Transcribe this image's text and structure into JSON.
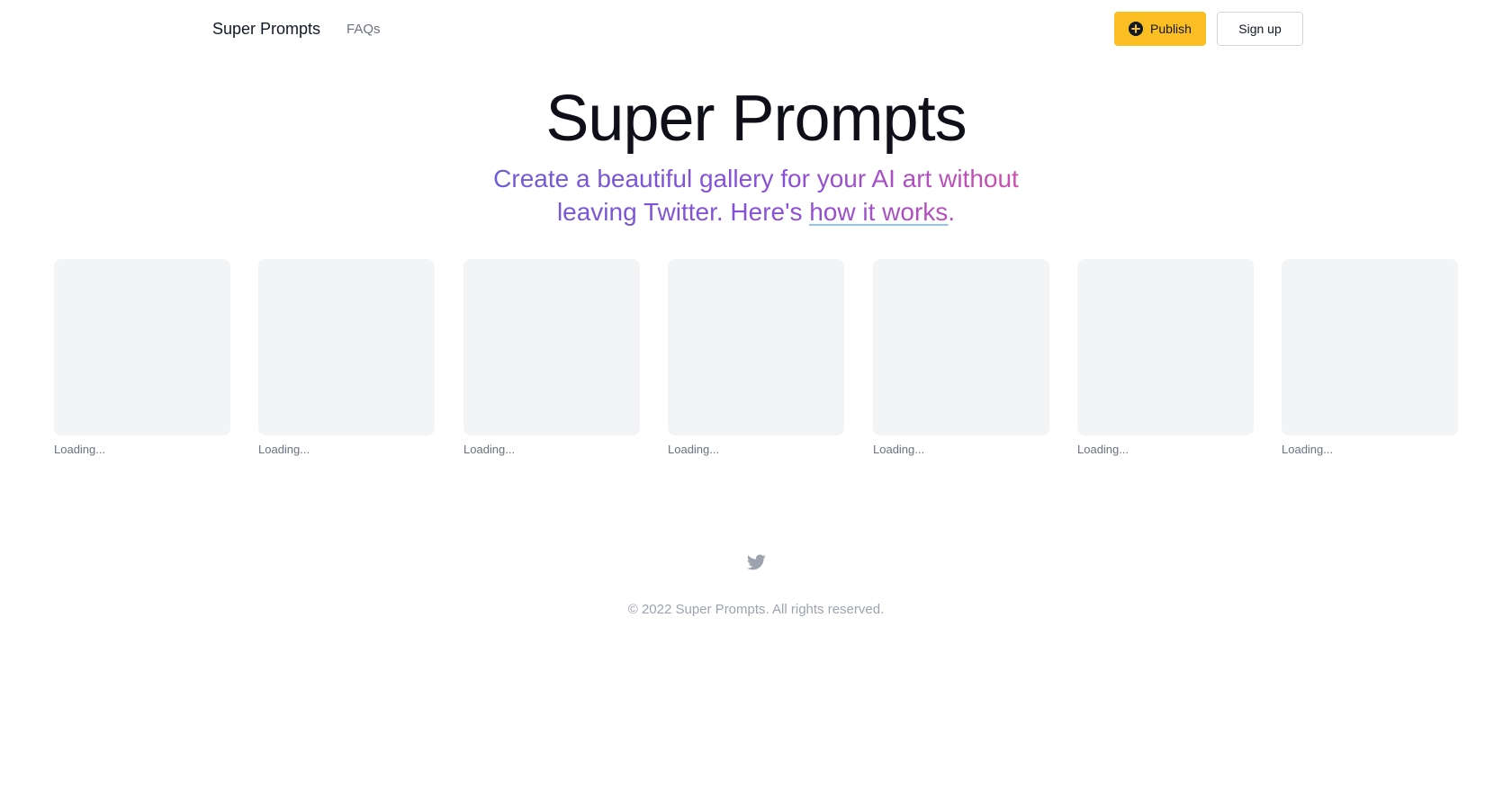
{
  "header": {
    "brand": "Super Prompts",
    "nav": {
      "faqs": "FAQs"
    },
    "publish_label": "Publish",
    "signup_label": "Sign up",
    "publish_icon": "plus-circle-icon"
  },
  "hero": {
    "title": "Super Prompts",
    "subtitle_before": "Create a beautiful gallery for your AI art without leaving Twitter. Here's ",
    "subtitle_link": "how it works",
    "subtitle_after": ".",
    "gradient_colors": [
      "#6d5bd6",
      "#8a4fd8",
      "#d54fa8"
    ]
  },
  "gallery": {
    "items": [
      {
        "caption": "Loading..."
      },
      {
        "caption": "Loading..."
      },
      {
        "caption": "Loading..."
      },
      {
        "caption": "Loading..."
      },
      {
        "caption": "Loading..."
      },
      {
        "caption": "Loading..."
      },
      {
        "caption": "Loading..."
      }
    ]
  },
  "footer": {
    "social_icon": "twitter-icon",
    "copyright": "© 2022 Super Prompts. All rights reserved."
  },
  "colors": {
    "accent": "#fbbf24",
    "placeholder": "#f3f4f6",
    "muted_text": "#6b7280"
  }
}
